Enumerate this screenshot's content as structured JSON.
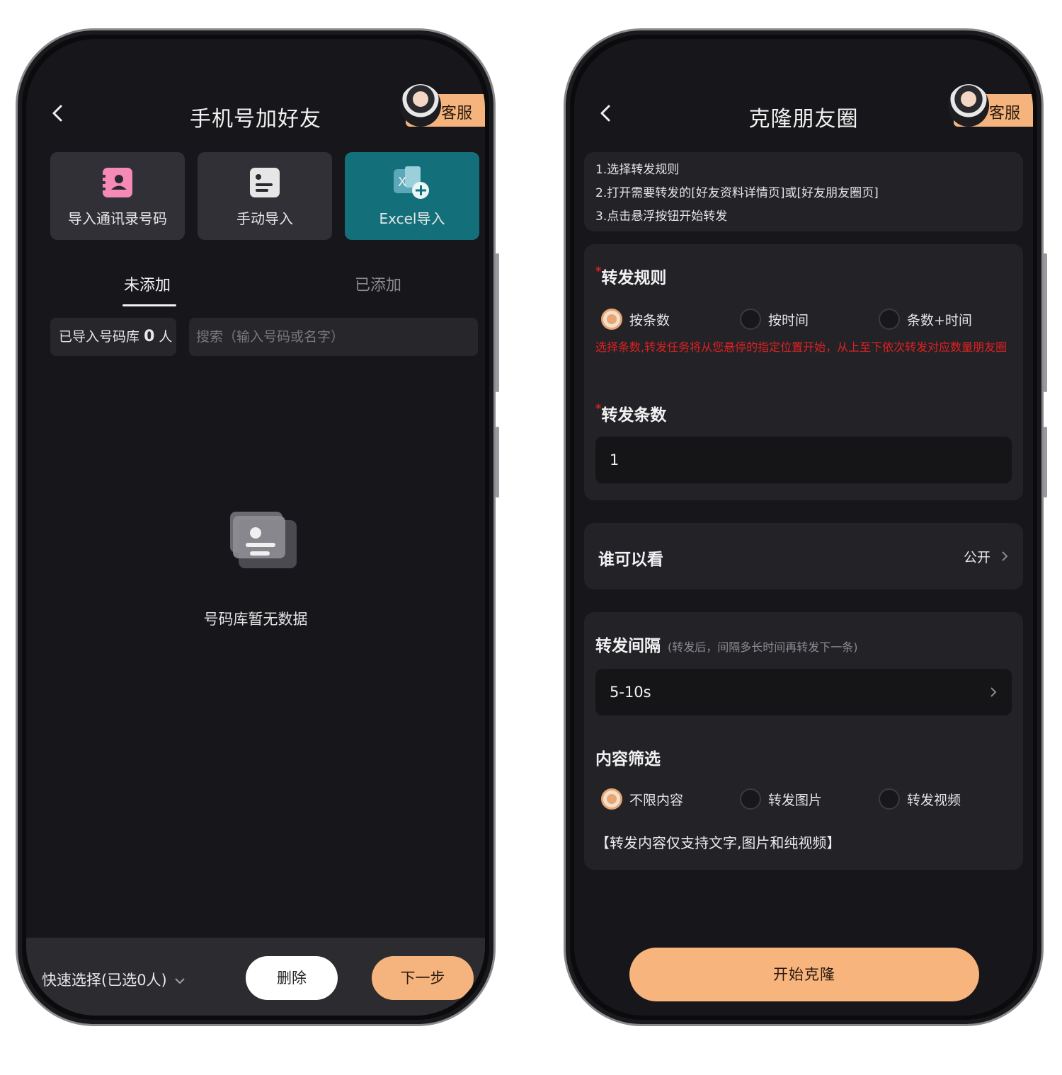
{
  "left": {
    "title": "手机号加好友",
    "service_label": "客服",
    "cards": [
      {
        "label": "导入通讯录号码",
        "icon": "contacts-book-icon"
      },
      {
        "label": "手动导入",
        "icon": "manual-entry-icon"
      },
      {
        "label": "Excel导入",
        "icon": "excel-import-icon"
      }
    ],
    "tabs": {
      "pending": "未添加",
      "added": "已添加"
    },
    "count": {
      "prefix": "已导入号码库",
      "value": "0",
      "suffix": "人"
    },
    "search_placeholder": "搜索（输入号码或名字）",
    "empty_text": "号码库暂无数据",
    "quick_select": "快速选择(已选0人)",
    "delete_label": "删除",
    "next_label": "下一步"
  },
  "right": {
    "title": "克隆朋友圈",
    "service_label": "客服",
    "steps": [
      "1.选择转发规则",
      "2.打开需要转发的[好友资料详情页]或[好友朋友圈页]",
      "3.点击悬浮按钮开始转发"
    ],
    "rule_title": "转发规则",
    "rule_options": [
      "按条数",
      "按时间",
      "条数+时间"
    ],
    "rule_selected": 0,
    "rule_warning": "选择条数,转发任务将从您悬停的指定位置开始，从上至下依次转发对应数量朋友圈",
    "count_title": "转发条数",
    "count_value": "1",
    "visibility_label": "谁可以看",
    "visibility_value": "公开",
    "interval_title": "转发间隔",
    "interval_hint": "(转发后，间隔多长时间再转发下一条)",
    "interval_value": "5-10s",
    "filter_title": "内容筛选",
    "filter_options": [
      "不限内容",
      "转发图片",
      "转发视频"
    ],
    "filter_selected": 0,
    "filter_note": "【转发内容仅支持文字,图片和纯视频】",
    "start_label": "开始克隆"
  },
  "colors": {
    "accent": "#f5b47d",
    "teal_card": "#13707a",
    "warning": "#e02020",
    "screen_bg": "#17171b"
  }
}
